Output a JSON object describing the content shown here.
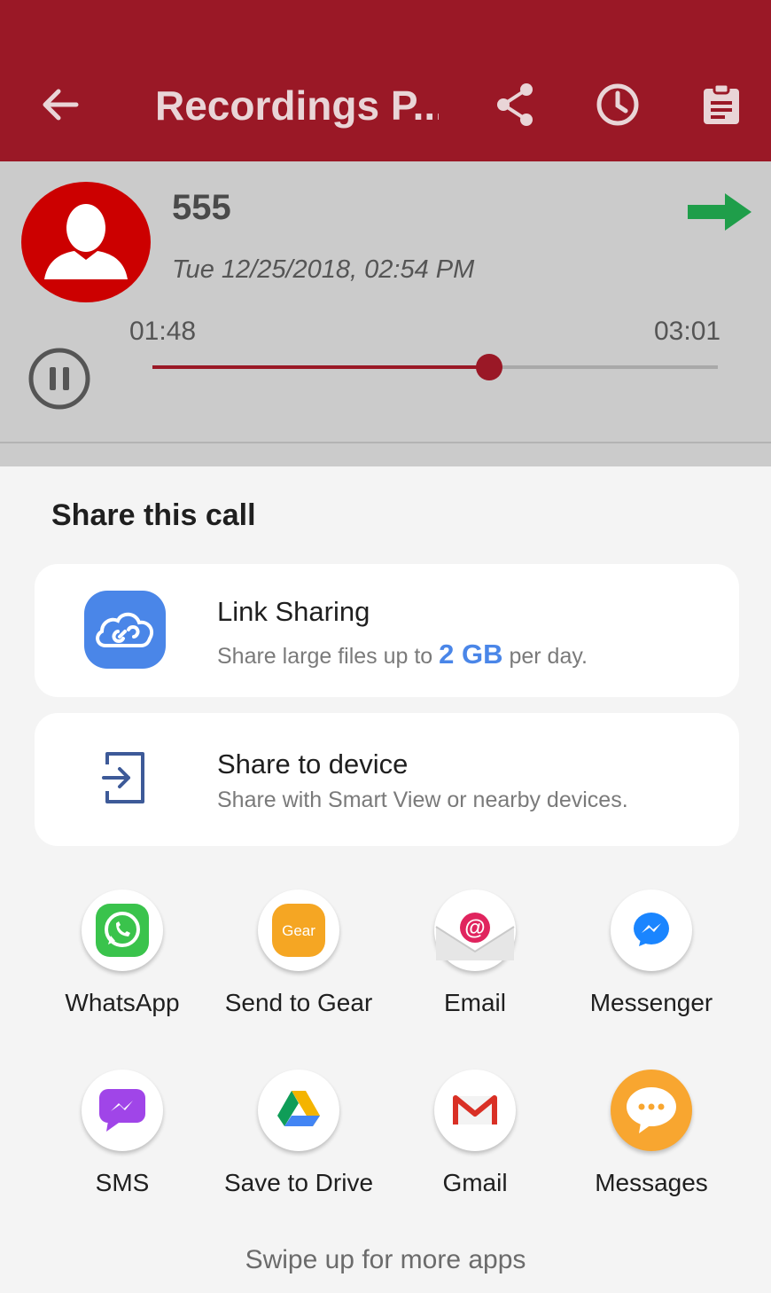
{
  "app_bar": {
    "title": "Recordings P...",
    "back_icon": "arrow-left-icon",
    "actions": [
      "share-icon",
      "clock-icon",
      "clipboard-icon"
    ]
  },
  "recording": {
    "number": "555",
    "datetime": "Tue 12/25/2018, 02:54 PM",
    "current_time": "01:48",
    "total_time": "03:01",
    "progress": 0.596,
    "colors": {
      "accent": "#9a1826",
      "avatar": "#cc0000",
      "arrow": "#1f9e4a"
    }
  },
  "share_sheet": {
    "title": "Share this call",
    "link_sharing": {
      "title": "Link Sharing",
      "sub_before": "Share large files up to ",
      "sub_highlight": "2 GB",
      "sub_after": " per day."
    },
    "share_to_device": {
      "title": "Share to device",
      "subtitle": "Share with Smart View or nearby devices."
    },
    "apps": [
      {
        "label": "WhatsApp",
        "icon": "whatsapp-icon"
      },
      {
        "label": "Send to Gear",
        "icon": "gear-icon"
      },
      {
        "label": "Email",
        "icon": "email-icon"
      },
      {
        "label": "Messenger",
        "icon": "messenger-icon"
      },
      {
        "label": "SMS",
        "icon": "sms-icon"
      },
      {
        "label": "Save to Drive",
        "icon": "drive-icon"
      },
      {
        "label": "Gmail",
        "icon": "gmail-icon"
      },
      {
        "label": "Messages",
        "icon": "messages-icon"
      }
    ],
    "gear_icon_text": "Gear",
    "footer": "Swipe up for more apps"
  }
}
